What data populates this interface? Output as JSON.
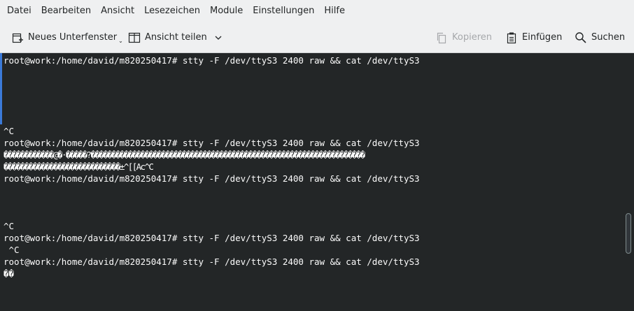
{
  "menubar": {
    "items": [
      "Datei",
      "Bearbeiten",
      "Ansicht",
      "Lesezeichen",
      "Module",
      "Einstellungen",
      "Hilfe"
    ]
  },
  "toolbar": {
    "new_tab_label": "Neues Unterfenster",
    "split_view_label": "Ansicht teilen",
    "copy_label": "Kopieren",
    "paste_label": "Einfügen",
    "find_label": "Suchen"
  },
  "terminal": {
    "lines": [
      "root@work:/home/david/m820250417# stty -F /dev/ttyS3 2400 raw && cat /dev/ttyS3",
      "^C",
      "root@work:/home/david/m820250417# stty -F /dev/ttyS3 2400 raw && cat /dev/ttyS3",
      "������������@�·�����?������������������������������������������������������������������",
      "����������������������������±^[[Ac^C",
      "root@work:/home/david/m820250417# stty -F /dev/ttyS3 2400 raw && cat /dev/ttyS3",
      "^C",
      "root@work:/home/david/m820250417# stty -F /dev/ttyS3 2400 raw && cat /dev/ttyS3",
      " ^C",
      "root@work:/home/david/m820250417# stty -F /dev/ttyS3 2400 raw && cat /dev/ttyS3",
      "��"
    ]
  },
  "colors": {
    "terminal_bg": "#232627",
    "terminal_fg": "#fcfcfc",
    "chrome_bg": "#eff0f1",
    "active_marker": "#3b7ad9"
  }
}
